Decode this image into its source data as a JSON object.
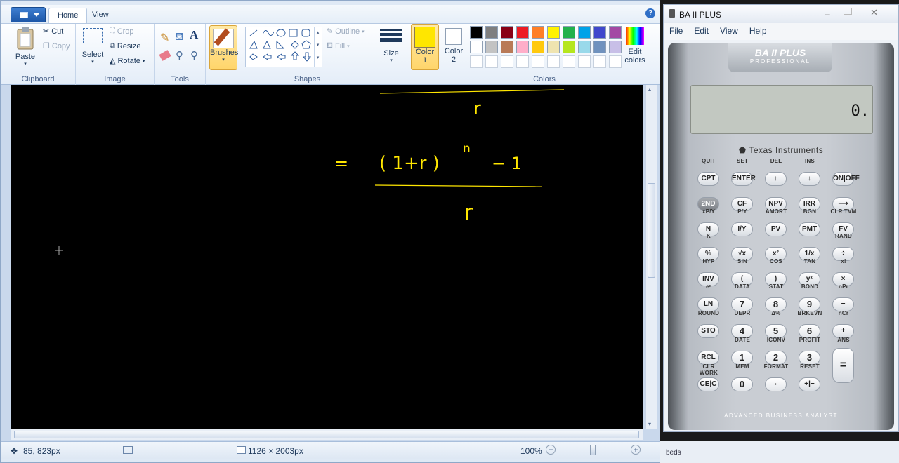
{
  "tabs": {
    "home": "Home",
    "view": "View"
  },
  "help": "?",
  "clipboard": {
    "paste": "Paste",
    "cut": "Cut",
    "copy": "Copy",
    "label": "Clipboard"
  },
  "image": {
    "select": "Select",
    "crop": "Crop",
    "resize": "Resize",
    "rotate": "Rotate",
    "label": "Image"
  },
  "tools": {
    "label": "Tools"
  },
  "brushes": {
    "label": "Brushes"
  },
  "shapes": {
    "outline": "Outline",
    "fill": "Fill",
    "label": "Shapes"
  },
  "size": {
    "label": "Size"
  },
  "color1": {
    "label": "Color",
    "num": "1",
    "value": "#ffe600"
  },
  "color2": {
    "label": "Color",
    "num": "2",
    "value": "#ffffff"
  },
  "colors": {
    "label": "Colors",
    "edit_line1": "Edit",
    "edit_line2": "colors",
    "row1": [
      "#000000",
      "#7f7f7f",
      "#880015",
      "#ed1c24",
      "#ff7f27",
      "#fff200",
      "#22b14c",
      "#00a2e8",
      "#3f48cc",
      "#a349a4"
    ],
    "row2": [
      "#ffffff",
      "#c3c3c3",
      "#b97a57",
      "#ffaec9",
      "#ffc90e",
      "#efe4b0",
      "#b5e61d",
      "#99d9ea",
      "#7092be",
      "#c8bfe7"
    ]
  },
  "status": {
    "coords": "85, 823px",
    "dimensions": "1126 × 2003px",
    "zoom": "100%"
  },
  "taskbar_snippet": "beds",
  "calc": {
    "title": "BA II PLUS",
    "menu": [
      "File",
      "Edit",
      "View",
      "Help"
    ],
    "brand_top": "BA II PLUS",
    "brand_sub": "PROFESSIONAL",
    "display": "0.",
    "maker": "Texas Instruments",
    "footer": "ADVANCED BUSINESS ANALYST",
    "sec_row0": [
      "QUIT",
      "SET",
      "DEL",
      "INS",
      ""
    ],
    "row0": [
      "CPT",
      "ENTER",
      "↑",
      "↓",
      "ON|OFF"
    ],
    "row1": [
      "2ND",
      "CF",
      "NPV",
      "IRR",
      "⟶"
    ],
    "sec_row2": [
      "xP/Y",
      "P/Y",
      "AMORT",
      "BGN",
      "CLR TVM"
    ],
    "row2": [
      "N",
      "I/Y",
      "PV",
      "PMT",
      "FV"
    ],
    "sec_row3": [
      "K",
      "",
      "",
      "",
      "RAND"
    ],
    "row3": [
      "%",
      "√x",
      "x²",
      "1/x",
      "÷"
    ],
    "sec_row4": [
      "HYP",
      "SIN",
      "COS",
      "TAN",
      "x!"
    ],
    "row4": [
      "INV",
      "(",
      ")",
      "yˣ",
      "×"
    ],
    "sec_row5": [
      "eˣ",
      "DATA",
      "STAT",
      "BOND",
      "nPr"
    ],
    "row5": [
      "LN",
      "7",
      "8",
      "9",
      "−"
    ],
    "sec_row6": [
      "ROUND",
      "DEPR",
      "Δ%",
      "BRKEVN",
      "nCr"
    ],
    "row6": [
      "STO",
      "4",
      "5",
      "6",
      "+"
    ],
    "sec_row7": [
      "",
      "DATE",
      "ICONV",
      "PROFIT",
      "ANS"
    ],
    "row7": [
      "RCL",
      "1",
      "2",
      "3",
      "="
    ],
    "sec_row8": [
      "CLR WORK",
      "MEM",
      "FORMAT",
      "RESET",
      ""
    ],
    "row8": [
      "CE|C",
      "0",
      "·",
      "+|−"
    ]
  },
  "drawing": {
    "r_top": "r",
    "equals": "=",
    "numerator": "( 1+r )",
    "exponent": "n",
    "minus_one": "− 1",
    "r_bottom": "r"
  }
}
